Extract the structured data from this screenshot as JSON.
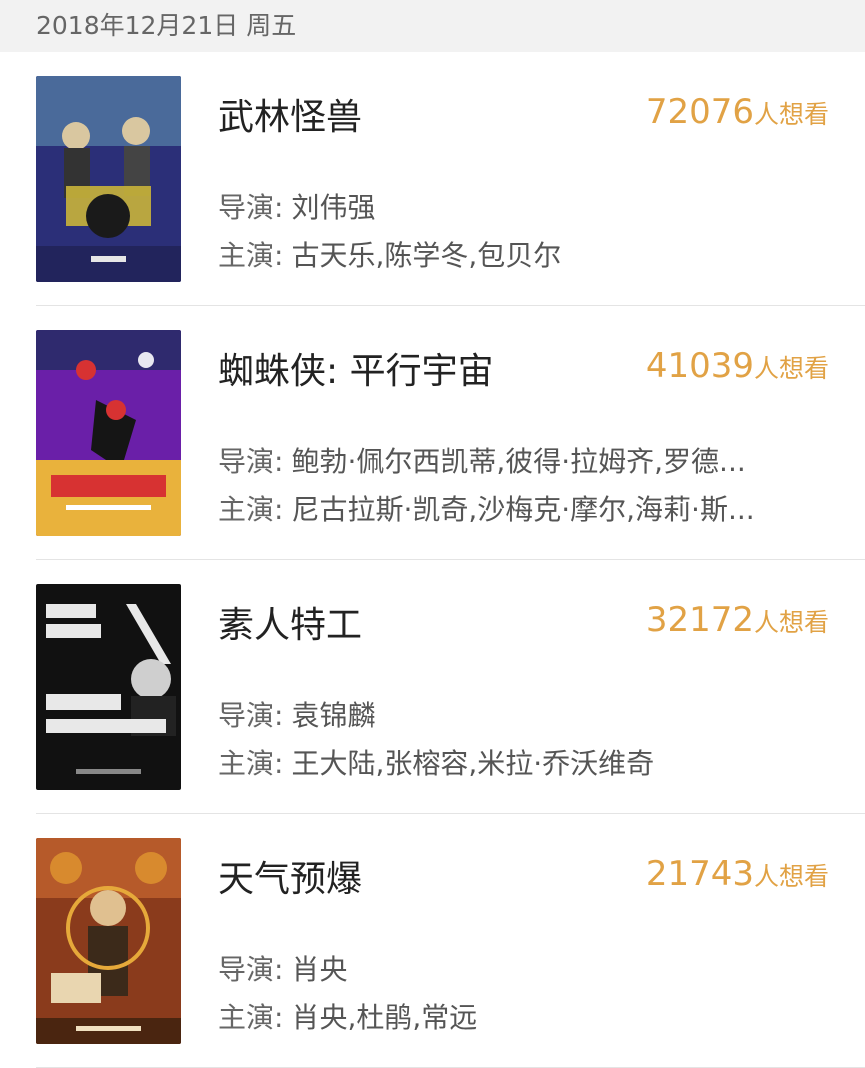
{
  "date_header": "2018年12月21日 周五",
  "colors": {
    "accent": "#e1a245",
    "header_bg": "#f2f2f2",
    "title": "#222222",
    "secondary_text": "#555555"
  },
  "labels": {
    "director": "导演:",
    "cast": "主演:",
    "want_to_see": "人想看"
  },
  "movies": [
    {
      "title": "武林怪兽",
      "wish_count": "72076",
      "director": "刘伟强",
      "cast": "古天乐,陈学冬,包贝尔",
      "poster_icon": "movie-poster-wulin",
      "poster_colors": [
        "#2b2f78",
        "#c9b43a",
        "#3a3a3a"
      ]
    },
    {
      "title": "蜘蛛侠: 平行宇宙",
      "wish_count": "41039",
      "director": "鲍勃·佩尔西凯蒂,彼得·拉姆齐,罗德...",
      "cast": "尼古拉斯·凯奇,沙梅克·摩尔,海莉·斯...",
      "poster_icon": "movie-poster-spiderman",
      "poster_colors": [
        "#6a1fa8",
        "#d73232",
        "#e9b23c"
      ]
    },
    {
      "title": "素人特工",
      "wish_count": "32172",
      "director": "袁锦麟",
      "cast": "王大陆,张榕容,米拉·乔沃维奇",
      "poster_icon": "movie-poster-agent",
      "poster_colors": [
        "#111111",
        "#e8e8e8",
        "#555555"
      ]
    },
    {
      "title": "天气预爆",
      "wish_count": "21743",
      "director": "肖央",
      "cast": "肖央,杜鹃,常远",
      "poster_icon": "movie-poster-weather",
      "poster_colors": [
        "#8a3b1c",
        "#d88a2e",
        "#3c2a1a"
      ]
    }
  ]
}
